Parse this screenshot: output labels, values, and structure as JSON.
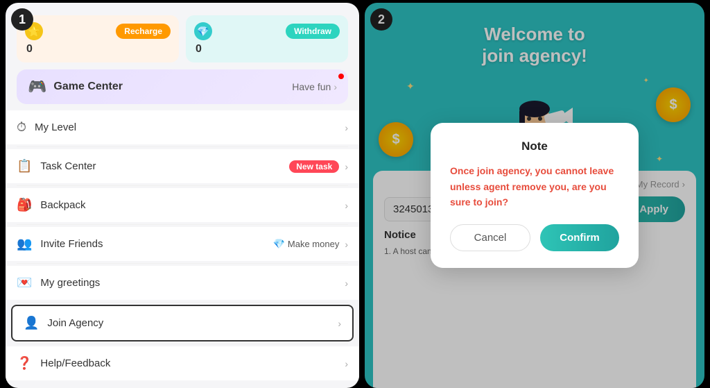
{
  "panel1": {
    "step": "1",
    "wallet": {
      "coin": {
        "amount": "0",
        "recharge_label": "Recharge"
      },
      "gem": {
        "amount": "0",
        "withdraw_label": "Withdraw"
      }
    },
    "game_center": {
      "label": "Game Center",
      "action": "Have fun",
      "icon": "🎮"
    },
    "menu_items": [
      {
        "id": "my-level",
        "icon": "⏱",
        "label": "My Level",
        "badge": "",
        "extra": ""
      },
      {
        "id": "task-center",
        "icon": "📋",
        "label": "Task Center",
        "badge": "New task",
        "extra": ""
      },
      {
        "id": "backpack",
        "icon": "🎒",
        "label": "Backpack",
        "badge": "",
        "extra": ""
      },
      {
        "id": "invite-friends",
        "icon": "👥",
        "label": "Invite Friends",
        "badge": "",
        "extra": "Make money"
      },
      {
        "id": "my-greetings",
        "icon": "💌",
        "label": "My greetings",
        "badge": "",
        "extra": ""
      },
      {
        "id": "join-agency",
        "icon": "👤",
        "label": "Join Agency",
        "badge": "",
        "extra": "",
        "highlighted": true
      },
      {
        "id": "help-feedback",
        "icon": "❓",
        "label": "Help/Feedback",
        "badge": "",
        "extra": ""
      }
    ]
  },
  "panel2": {
    "step": "2",
    "title_line1": "Welcome to",
    "title_line2": "join agency!",
    "modal": {
      "title": "Note",
      "body": "Once join agency, you cannot leave unless agent remove you, are you sure to join?",
      "cancel_label": "Cancel",
      "confirm_label": "Confirm"
    },
    "my_record_label": "My Record",
    "agent_id_value": "32450133",
    "apply_label": "Apply",
    "notice_title": "Notice",
    "notice_item": "1. A host can only apply for the agent once at"
  }
}
